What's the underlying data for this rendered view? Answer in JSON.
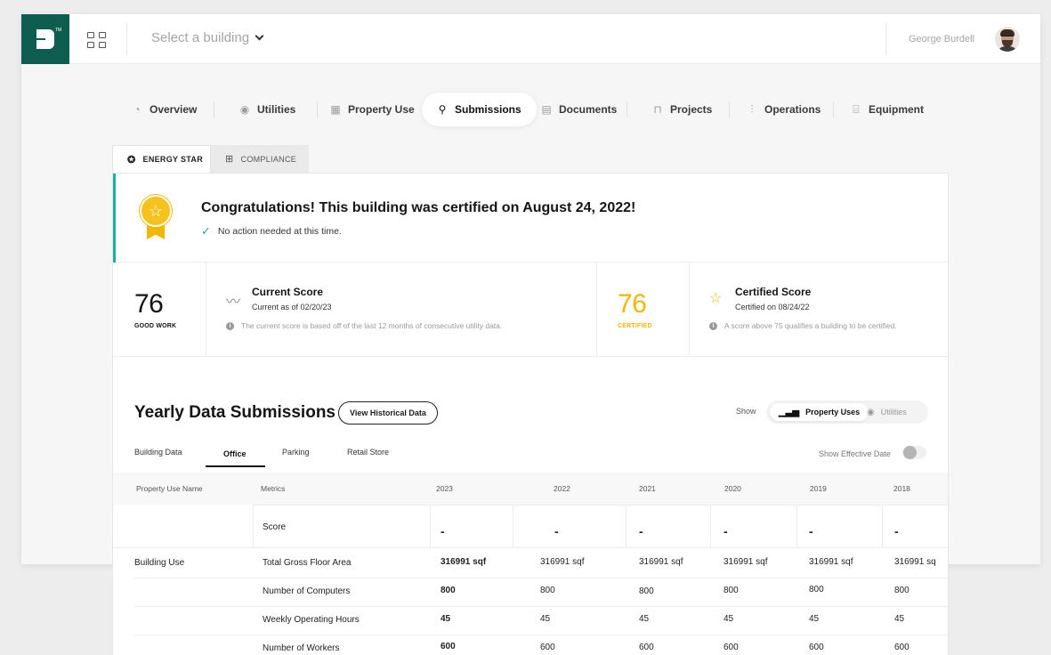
{
  "header": {
    "building_select": "Select a building",
    "user_name": "George Burdell",
    "logo_mark": "TM"
  },
  "nav": {
    "items": [
      {
        "label": "Overview",
        "icon": "overview-icon"
      },
      {
        "label": "Utilities",
        "icon": "utilities-icon"
      },
      {
        "label": "Property Use",
        "icon": "building-icon"
      },
      {
        "label": "Submissions",
        "icon": "pin-icon",
        "active": true
      },
      {
        "label": "Documents",
        "icon": "document-icon"
      },
      {
        "label": "Projects",
        "icon": "trash-icon"
      },
      {
        "label": "Operations",
        "icon": "sliders-icon"
      },
      {
        "label": "Equipment",
        "icon": "equipment-icon"
      }
    ]
  },
  "subtabs": {
    "energy_star": "ENERGY STAR",
    "compliance": "COMPLIANCE"
  },
  "banner": {
    "title": "Congratulations! This building was certified on August 24, 2022!",
    "subtitle": "No action needed at this time.",
    "accent_color": "#17b29c",
    "medal_color": "#f7c21b"
  },
  "current_score": {
    "value": "76",
    "tag": "GOOD WORK",
    "title": "Current Score",
    "date": "Current as of 02/20/23",
    "note": "The current score is based off of the last 12 months of consecutive utility data."
  },
  "certified_score": {
    "value": "76",
    "tag": "CERTIFIED",
    "title": "Certified Score",
    "date": "Certified on 08/24/22",
    "note": "A score above 75 qualifies a building to be certified.",
    "color": "#f2b705"
  },
  "yearly": {
    "title": "Yearly Data Submissions",
    "history_button": "View Historical Data",
    "show_label": "Show",
    "toggle_on": "Property Uses",
    "toggle_off": "Utilities",
    "tabs": [
      "Building Data",
      "Office",
      "Parking",
      "Retail Store"
    ],
    "active_tab": "Office",
    "effective_date_label": "Show Effective Date"
  },
  "table": {
    "headers": [
      "Property Use Name",
      "Metrics",
      "2023",
      "2022",
      "2021",
      "2020",
      "2019",
      "2018"
    ],
    "score_row": {
      "metric": "Score",
      "values": [
        "-",
        "-",
        "-",
        "-",
        "-",
        "-"
      ]
    },
    "group_name": "Building Use",
    "rows": [
      {
        "metric": "Total Gross Floor Area",
        "values": [
          "316991 sqf",
          "316991 sqf",
          "316991 sqf",
          "316991 sqf",
          "316991 sqf",
          "316991 sq"
        ]
      },
      {
        "metric": "Number of Computers",
        "values": [
          "800",
          "800",
          "800",
          "800",
          "800",
          "800"
        ]
      },
      {
        "metric": "Weekly Operating Hours",
        "values": [
          "45",
          "45",
          "45",
          "45",
          "45",
          "45"
        ]
      },
      {
        "metric": "Number of Workers",
        "values": [
          "600",
          "600",
          "600",
          "600",
          "600",
          "600"
        ]
      }
    ]
  }
}
